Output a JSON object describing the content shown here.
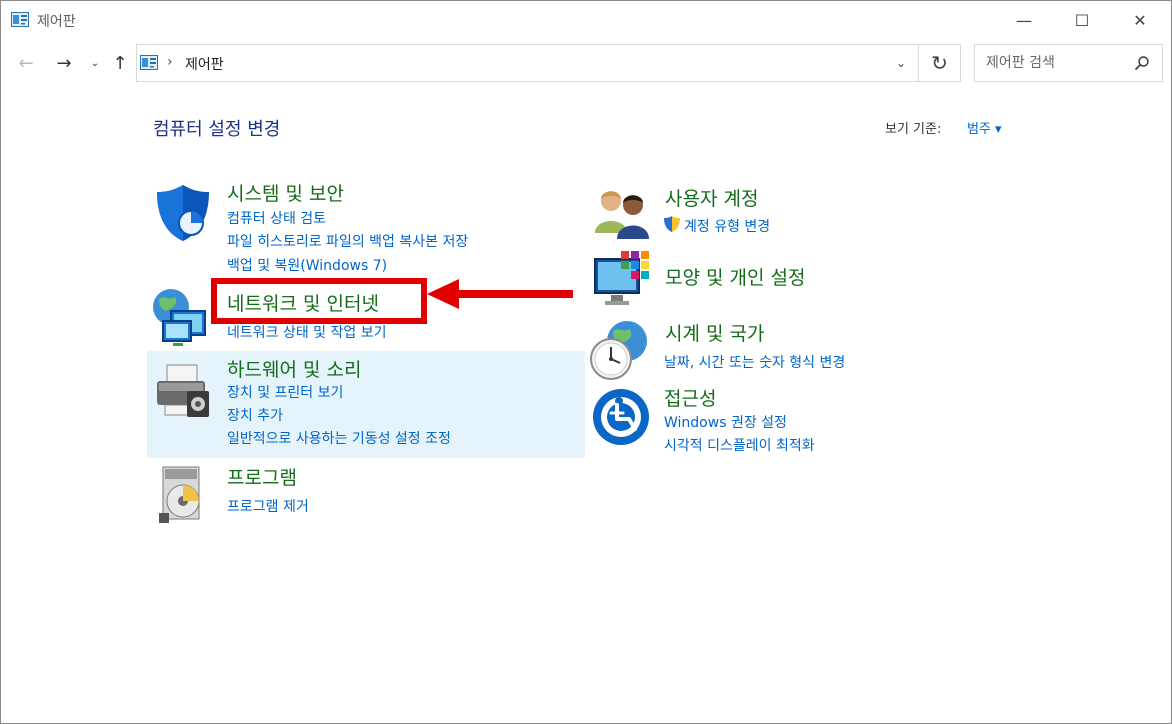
{
  "window": {
    "title": "제어판",
    "controls": {
      "minimize": "—",
      "maximize": "☐",
      "close": "✕"
    }
  },
  "nav": {
    "back": "←",
    "forward": "→",
    "recent": "⌄",
    "up": "↑"
  },
  "address": {
    "separator": "›",
    "crumb": "제어판",
    "dropdown": "⌄",
    "refresh": "↻"
  },
  "search": {
    "placeholder": "제어판 검색"
  },
  "main": {
    "title": "컴퓨터 설정 변경",
    "view_by_label": "보기 기준:",
    "view_by_value": "범주 ▾"
  },
  "categories": {
    "system": {
      "title": "시스템 및 보안",
      "links": [
        "컴퓨터 상태 검토",
        "파일 히스토리로 파일의 백업 복사본 저장",
        "백업 및 복원(Windows 7)"
      ]
    },
    "network": {
      "title": "네트워크 및 인터넷",
      "links": [
        "네트워크 상태 및 작업 보기"
      ]
    },
    "hardware": {
      "title": "하드웨어 및 소리",
      "links": [
        "장치 및 프린터 보기",
        "장치 추가",
        "일반적으로 사용하는 기동성 설정 조정"
      ]
    },
    "programs": {
      "title": "프로그램",
      "links": [
        "프로그램 제거"
      ]
    },
    "users": {
      "title": "사용자 계정",
      "links": [
        "계정 유형 변경"
      ]
    },
    "appearance": {
      "title": "모양 및 개인 설정",
      "links": []
    },
    "clock": {
      "title": "시계 및 국가",
      "links": [
        "날짜, 시간 또는 숫자 형식 변경"
      ]
    },
    "access": {
      "title": "접근성",
      "links": [
        "Windows 권장 설정",
        "시각적 디스플레이 최적화"
      ]
    }
  },
  "colors": {
    "category_title": "#146c1a",
    "link": "#0066cc",
    "page_title": "#1e3287",
    "highlight": "#e00000",
    "hover": "#e5f3fb"
  }
}
